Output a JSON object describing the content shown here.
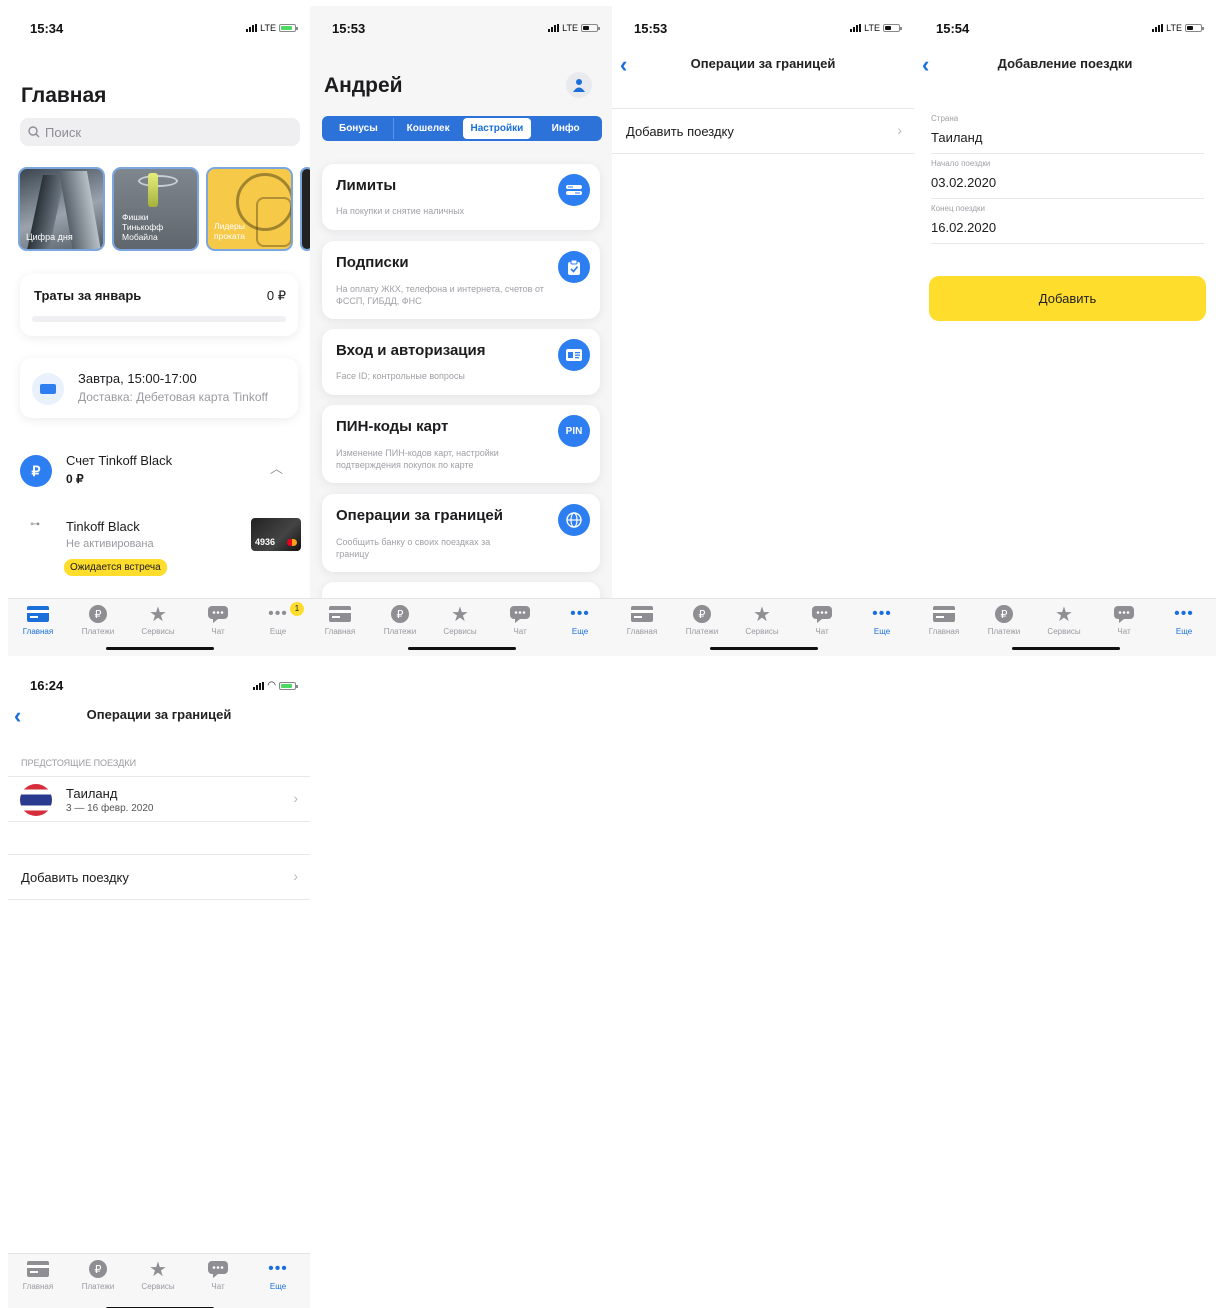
{
  "tabs": {
    "home": "Главная",
    "payments": "Платежи",
    "services": "Сервисы",
    "chat": "Чат",
    "more": "Еще"
  },
  "s1": {
    "time": "15:34",
    "net": "LTE",
    "title": "Главная",
    "search_placeholder": "Поиск",
    "stories": [
      "Цифра дня",
      "Фишки Тинькофф Мобайла",
      "Лидеры проката"
    ],
    "spend_title": "Траты за январь",
    "spend_value": "0 ₽",
    "delivery_time": "Завтра, 15:00-17:00",
    "delivery_desc": "Доставка: Дебетовая карта Tinkoff",
    "account_name": "Счет Tinkoff Black",
    "account_balance": "0 ₽",
    "card_name": "Tinkoff Black",
    "card_status": "Не активирована",
    "card_badge": "Ожидается встреча",
    "card_number": "4936",
    "more_badge": "1"
  },
  "s2": {
    "time": "15:53",
    "net": "LTE",
    "user": "Андрей",
    "segments": [
      "Бонусы",
      "Кошелек",
      "Настройки",
      "Инфо"
    ],
    "items": [
      {
        "title": "Лимиты",
        "desc": "На покупки и снятие наличных",
        "icon": "limits-icon"
      },
      {
        "title": "Подписки",
        "desc": "На оплату ЖКХ, телефона и интернета, счетов от ФССП, ГИБДД, ФНС",
        "icon": "subscriptions-icon"
      },
      {
        "title": "Вход и авторизация",
        "desc": "Face ID; контрольные вопросы",
        "icon": "id-card-icon"
      },
      {
        "title": "ПИН-коды карт",
        "desc": "Изменение ПИН-кодов карт, настройки подтверждения покупок по карте",
        "icon": "pin-icon",
        "icon_text": "PIN"
      },
      {
        "title": "Операции за границей",
        "desc": "Сообщить банку о своих поездках за границу",
        "icon": "globe-icon"
      }
    ]
  },
  "s3": {
    "time": "15:53",
    "net": "LTE",
    "title": "Операции за границей",
    "add_trip": "Добавить поездку"
  },
  "s4": {
    "time": "15:54",
    "net": "LTE",
    "title": "Добавление поездки",
    "country_label": "Страна",
    "country_value": "Таиланд",
    "start_label": "Начало поездки",
    "start_value": "03.02.2020",
    "end_label": "Конец поездки",
    "end_value": "16.02.2020",
    "button": "Добавить"
  },
  "s5": {
    "time": "16:24",
    "title": "Операции за границей",
    "section": "ПРЕДСТОЯЩИЕ ПОЕЗДКИ",
    "trip_country": "Таиланд",
    "trip_dates": "3 — 16 февр. 2020",
    "add_trip": "Добавить поездку"
  }
}
